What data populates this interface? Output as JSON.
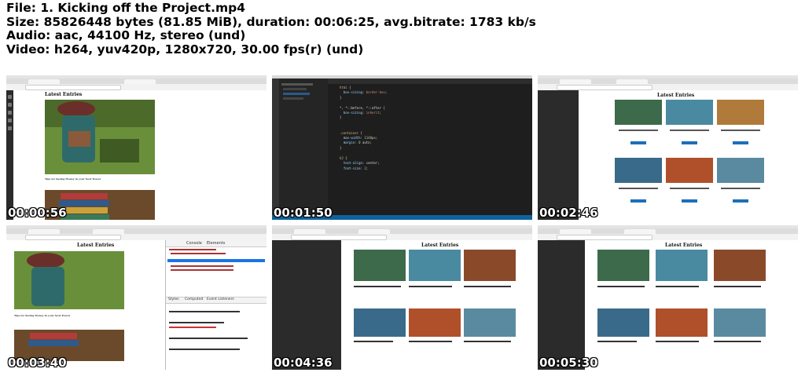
{
  "header": {
    "file": "File: 1. Kicking off the Project.mp4",
    "size": "Size: 85826448 bytes (81.85 MiB), duration: 00:06:25, avg.bitrate: 1783 kb/s",
    "audio": "Audio: aac, 44100 Hz, stereo (und)",
    "video": "Video: h264, yuv420p, 1280x720, 30.00 fps(r) (und)"
  },
  "thumbnails": [
    {
      "timestamp": "00:00:56",
      "heading": "Latest Entries",
      "caption": "Tips for Saving Money in your Next Travel"
    },
    {
      "timestamp": "00:01:50"
    },
    {
      "timestamp": "00:02:46",
      "heading": "Latest Entries"
    },
    {
      "timestamp": "00:03:40",
      "heading": "Latest Entries",
      "caption": "Tips for Saving Money in your Next Travel",
      "devtools_tabs": [
        "Console",
        "Elements"
      ],
      "style_tabs": [
        "Styles",
        "Computed",
        "Event Listeners"
      ]
    },
    {
      "timestamp": "00:04:36",
      "heading": "Latest Entries"
    },
    {
      "timestamp": "00:05:30",
      "heading": "Latest Entries"
    }
  ],
  "card_titles": [
    "Tips for Saving Money in your Next Travel",
    "The Complete Guide for Traveling",
    "Ultimate Guide to Take the best Pictures",
    "Checklist for your next Travel",
    "Best Places to visit next Autumn",
    "Best Places to Visit with Mountains"
  ],
  "colors": {
    "accent_button": "#1e6fb8",
    "editor_bg": "#1e1e1e",
    "status_bar": "#0e639c",
    "devtools_highlight": "#1a73e8"
  }
}
